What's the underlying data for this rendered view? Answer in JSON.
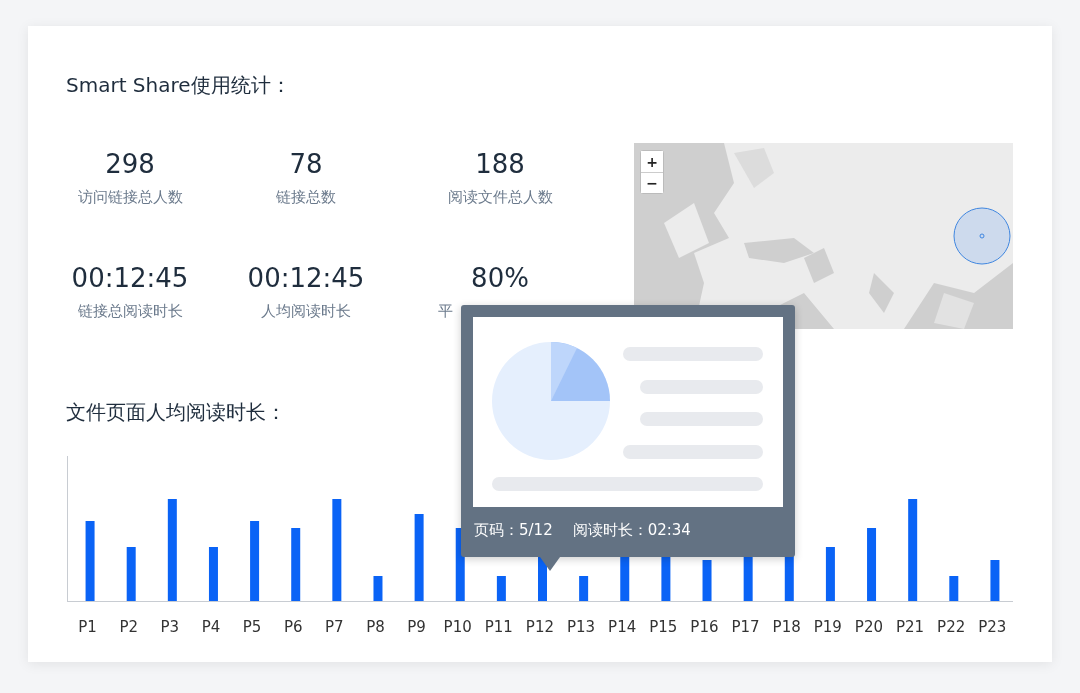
{
  "title": "Smart Share使用统计：",
  "stats": [
    {
      "value": "298",
      "label": "访问链接总人数"
    },
    {
      "value": "78",
      "label": "链接总数"
    },
    {
      "value": "188",
      "label": "阅读文件总人数"
    },
    {
      "value": "00:12:45",
      "label": "链接总阅读时长"
    },
    {
      "value": "00:12:45",
      "label": "人均阅读时长"
    },
    {
      "value": "80%",
      "label": "平"
    }
  ],
  "map": {
    "kind": "picture",
    "zoom_buttons": [
      "+",
      "−"
    ]
  },
  "chart_title": "文件页面人均阅读时长：",
  "chart_labels": [
    "P1",
    "P2",
    "P3",
    "P4",
    "P5",
    "P6",
    "P7",
    "P8",
    "P9",
    "P10",
    "P11",
    "P12",
    "P13",
    "P14",
    "P15",
    "P16",
    "P17",
    "P18",
    "P19",
    "P20",
    "P21",
    "P22",
    "P23"
  ],
  "tooltip": {
    "page": "页码：5/12",
    "duration": "阅读时长：02:34"
  }
}
